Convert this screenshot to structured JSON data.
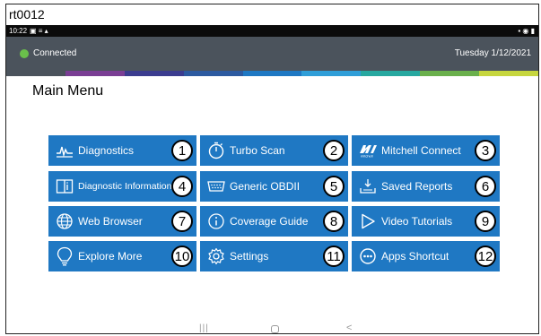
{
  "caption": "rt0012",
  "statusbar": {
    "time": "10:22",
    "left_icons": "▣ ≡ ▴",
    "right_icons": "▪ ◉ ▮"
  },
  "header": {
    "connection": "Connected",
    "date": "Tuesday 1/12/2021",
    "connected_color": "#6abf4b"
  },
  "stripe_colors": [
    "#4b535c",
    "#7a3e94",
    "#3b3c8f",
    "#2c5aa0",
    "#1f78c3",
    "#2f9ed8",
    "#27a8a0",
    "#6ab04c",
    "#c6d63e"
  ],
  "main_title": "Main Menu",
  "tiles": [
    {
      "label": "Diagnostics",
      "number": "1",
      "icon": "diagnostics-icon"
    },
    {
      "label": "Turbo Scan",
      "number": "2",
      "icon": "stopwatch-icon"
    },
    {
      "label": "Mitchell Connect",
      "number": "3",
      "icon": "mitchell-logo-icon"
    },
    {
      "label": "Diagnostic Information",
      "number": "4",
      "icon": "book-icon"
    },
    {
      "label": "Generic OBDII",
      "number": "5",
      "icon": "obd-connector-icon"
    },
    {
      "label": "Saved Reports",
      "number": "6",
      "icon": "download-icon"
    },
    {
      "label": "Web Browser",
      "number": "7",
      "icon": "globe-icon"
    },
    {
      "label": "Coverage Guide",
      "number": "8",
      "icon": "info-icon"
    },
    {
      "label": "Video Tutorials",
      "number": "9",
      "icon": "play-icon"
    },
    {
      "label": "Explore More",
      "number": "10",
      "icon": "lightbulb-icon"
    },
    {
      "label": "Settings",
      "number": "11",
      "icon": "gear-icon"
    },
    {
      "label": "Apps Shortcut",
      "number": "12",
      "icon": "apps-icon"
    }
  ],
  "nav": {
    "recents": "|||",
    "back": "<"
  }
}
